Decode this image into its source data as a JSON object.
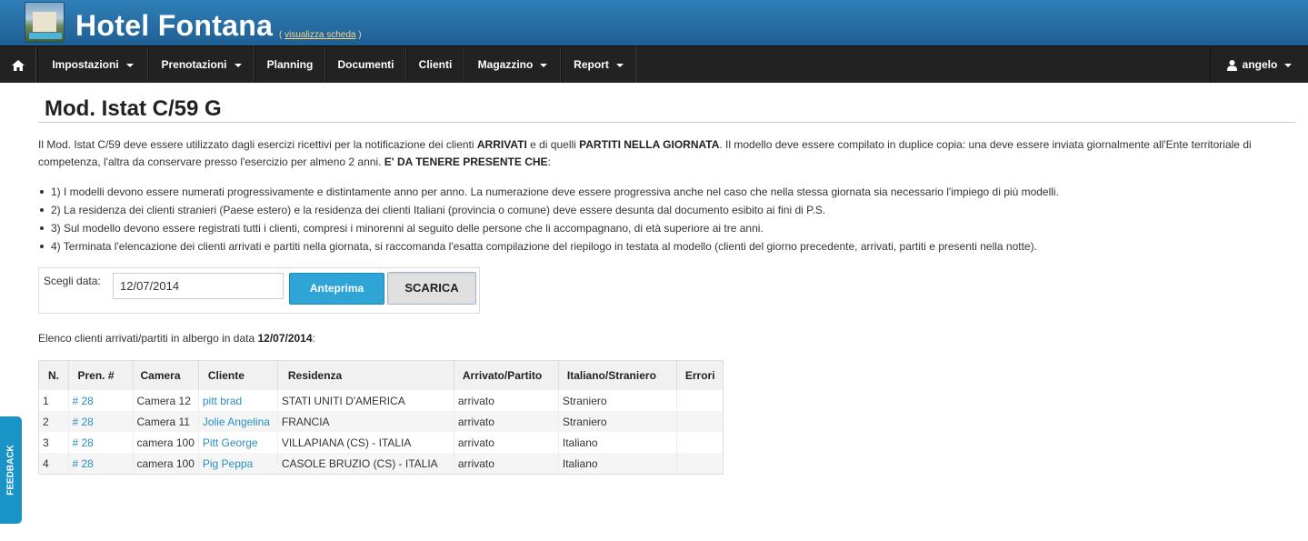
{
  "header": {
    "title": "Hotel Fontana",
    "view_link_open": "( ",
    "view_link": "visualizza scheda",
    "view_link_close": " )"
  },
  "nav": {
    "home_icon": "home-icon",
    "items": [
      {
        "label": "Impostazioni"
      },
      {
        "label": "Prenotazioni"
      },
      {
        "label": "Planning"
      },
      {
        "label": "Documenti"
      },
      {
        "label": "Clienti"
      },
      {
        "label": "Magazzino"
      },
      {
        "label": "Report"
      }
    ],
    "user": {
      "icon": "user-icon",
      "label": "angelo"
    }
  },
  "page": {
    "title": "Mod. Istat C/59 G",
    "intro": {
      "p1": "Il Mod. Istat C/59 deve essere utilizzato dagli esercizi ricettivi per la notificazione dei clienti ",
      "b1": "ARRIVATI",
      "p2": " e di quelli ",
      "b2": "PARTITI NELLA GIORNATA",
      "p3": ". Il modello deve essere compilato in duplice copia: una deve essere inviata giornalmente all'Ente territoriale di competenza, l'altra da conservare presso l'esercizio per almeno 2 anni. ",
      "b3": "E' DA TENERE PRESENTE CHE",
      "p4": ":"
    },
    "rules": [
      "1) I modelli devono essere numerati progressivamente e distintamente anno per anno. La numerazione deve essere progressiva anche nel caso che nella stessa giornata sia necessario l'impiego di più modelli.",
      "2) La residenza dei clienti stranieri (Paese estero) e la residenza dei clienti Italiani (provincia o comune) deve essere desunta dal documento esibito ai fini di P.S.",
      "3) Sul modello devono essere registrati tutti i clienti, compresi i minorenni al seguito delle persone che li accompagnano, di età superiore ai tre anni.",
      "4) Terminata l'elencazione dei clienti arrivati e partiti nella giornata, si raccomanda l'esatta compilazione del riepilogo in testata al modello (clienti del giorno precedente, arrivati, partiti e presenti nella notte)."
    ],
    "date_form": {
      "label": "Scegli data:",
      "value": "12/07/2014",
      "preview_button": "Anteprima",
      "download_button": "SCARICA"
    },
    "list_caption": {
      "prefix": "Elenco clienti arrivati/partiti in albergo in data ",
      "date": "12/07/2014",
      "suffix": ":"
    },
    "table": {
      "columns": [
        "N.",
        "Pren. #",
        "Camera",
        "Cliente",
        "Residenza",
        "Arrivato/Partito",
        "Italiano/Straniero",
        "Errori"
      ],
      "rows": [
        {
          "n": "1",
          "pren": "# 28",
          "camera": "Camera 12",
          "cliente": "pitt brad",
          "residenza": "STATI UNITI D'AMERICA",
          "stato": "arrivato",
          "naz": "Straniero",
          "errori": ""
        },
        {
          "n": "2",
          "pren": "# 28",
          "camera": "Camera 11",
          "cliente": "Jolie Angelina",
          "residenza": "FRANCIA",
          "stato": "arrivato",
          "naz": "Straniero",
          "errori": ""
        },
        {
          "n": "3",
          "pren": "# 28",
          "camera": "camera 100",
          "cliente": "Pitt George",
          "residenza": "VILLAPIANA (CS) - ITALIA",
          "stato": "arrivato",
          "naz": "Italiano",
          "errori": ""
        },
        {
          "n": "4",
          "pren": "# 28",
          "camera": "camera 100",
          "cliente": "Pig Peppa",
          "residenza": "CASOLE BRUZIO (CS) - ITALIA",
          "stato": "arrivato",
          "naz": "Italiano",
          "errori": ""
        }
      ]
    }
  },
  "feedback_tab": "FEEDBACK",
  "colors": {
    "brand_bar": "#2a74ab",
    "navbar": "#222222",
    "accent_button": "#2fa4d6",
    "link": "#2a8fc2"
  }
}
